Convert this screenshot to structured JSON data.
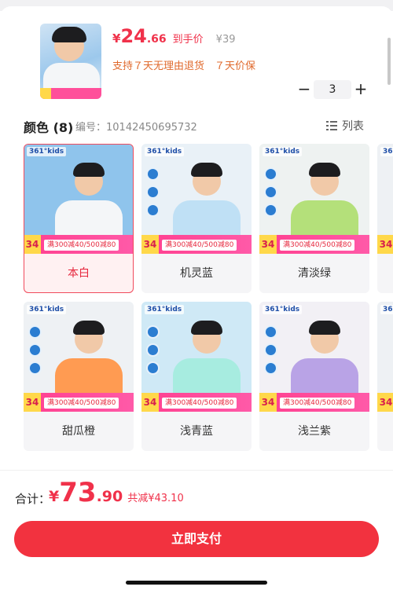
{
  "product": {
    "currency": "¥",
    "price_int": "24",
    "price_dec": ".66",
    "hand_price_label": "到手价",
    "original_price": "¥39",
    "policy": "支持７天无理由退货　７天价保"
  },
  "quantity": {
    "minus": "−",
    "value": "3",
    "plus": "+"
  },
  "color_section": {
    "title": "颜色 (8)",
    "sku_label": "编号：10142450695732",
    "list_label": "列表"
  },
  "variants": [
    {
      "name": "本白",
      "shirt_color": "#f4f6f8",
      "bg": "#8fc4ec",
      "selected": true
    },
    {
      "name": "机灵蓝",
      "shirt_color": "#bfe0f5",
      "bg": "#e9f1f7",
      "selected": false
    },
    {
      "name": "清淡绿",
      "shirt_color": "#b4e07a",
      "bg": "#eef2f1",
      "selected": false
    },
    {
      "name": "甜瓜橙",
      "shirt_color": "#ff9b52",
      "bg": "#eef1f4",
      "selected": false
    },
    {
      "name": "浅青蓝",
      "shirt_color": "#a7ece0",
      "bg": "#cfe9f6",
      "selected": false
    },
    {
      "name": "浅兰紫",
      "shirt_color": "#b9a3e6",
      "bg": "#f2f0f5",
      "selected": false
    }
  ],
  "promo": {
    "badge_number": "34",
    "text": "满300减40/500减80",
    "brand": "361°kids"
  },
  "footer": {
    "total_label": "合计：",
    "currency": "¥",
    "total_int": "73",
    "total_dec": ".90",
    "discount": "共减¥43.10",
    "pay_button": "立即支付"
  },
  "colors": {
    "accent": "#f0314a",
    "pay_button": "#f2323f",
    "policy_text": "#e06a2d"
  }
}
